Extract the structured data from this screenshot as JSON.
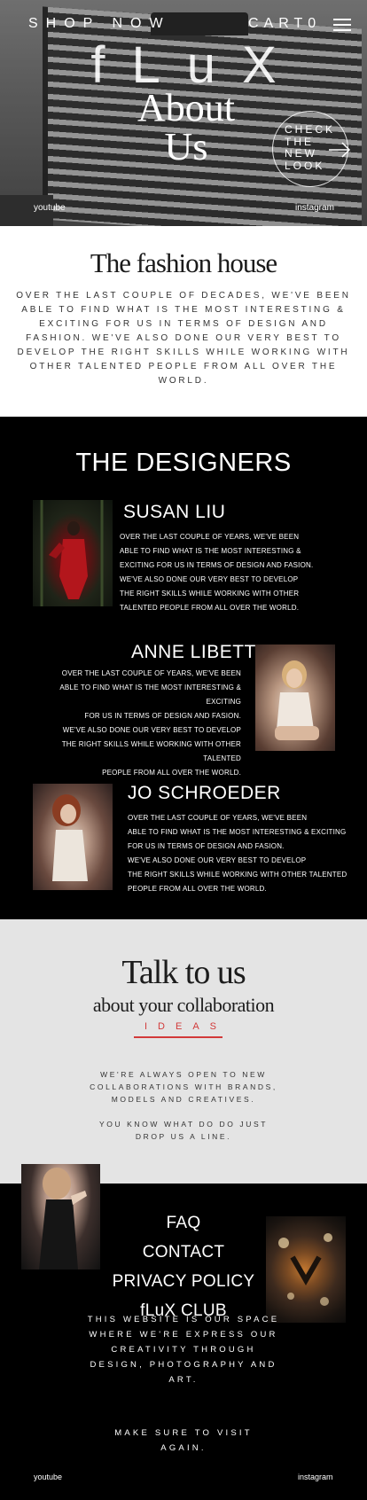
{
  "header": {
    "shop_label": "SHOP NOW",
    "cart_label": "CART0",
    "menu_icon": "hamburger-menu-icon",
    "brand": "fLuX"
  },
  "hero": {
    "title_line1": "About",
    "title_line2": "Us",
    "cta_line1": "CHECK",
    "cta_line2": "THE",
    "cta_line3": "NEW",
    "cta_line4": "LOOK",
    "cta_icon": "arrow-right-icon",
    "youtube": "youtube",
    "instagram": "instagram"
  },
  "fashion": {
    "title": "The fashion house",
    "text": "OVER THE LAST COUPLE OF DECADES, WE'VE BEEN ABLE TO FIND WHAT IS THE MOST INTERESTING & EXCITING FOR US IN TERMS OF DESIGN AND FASHION. WE'VE ALSO DONE OUR VERY BEST TO DEVELOP THE RIGHT SKILLS WHILE WORKING WITH OTHER TALENTED PEOPLE FROM ALL OVER THE WORLD."
  },
  "designers": {
    "title": "THE DESIGNERS",
    "items": [
      {
        "name": "SUSAN LIU",
        "lines": [
          "OVER THE LAST COUPLE OF YEARS, WE'VE BEEN",
          "ABLE TO FIND WHAT IS THE MOST INTERESTING &",
          "EXCITING FOR US IN TERMS OF DESIGN AND FASION.",
          "WE'VE ALSO DONE OUR VERY BEST TO DEVELOP",
          "THE RIGHT SKILLS WHILE WORKING WITH OTHER",
          "TALENTED PEOPLE FROM ALL OVER THE WORLD."
        ]
      },
      {
        "name": "ANNE LIBETT",
        "lines": [
          "OVER THE LAST COUPLE OF YEARS, WE'VE BEEN",
          "ABLE TO FIND WHAT IS THE MOST INTERESTING & EXCITING",
          "FOR US IN TERMS OF DESIGN AND FASION.",
          "WE'VE ALSO DONE OUR VERY BEST TO DEVELOP",
          "THE RIGHT SKILLS WHILE WORKING WITH OTHER TALENTED",
          "PEOPLE FROM ALL OVER THE WORLD."
        ]
      },
      {
        "name": "JO SCHROEDER",
        "lines": [
          "OVER THE LAST COUPLE OF YEARS, WE'VE BEEN",
          "ABLE TO FIND WHAT IS THE MOST INTERESTING & EXCITING",
          "FOR US IN TERMS OF DESIGN AND FASION.",
          "WE'VE ALSO DONE OUR VERY BEST TO DEVELOP",
          "THE RIGHT SKILLS WHILE WORKING WITH OTHER TALENTED",
          "PEOPLE FROM ALL OVER THE WORLD."
        ]
      }
    ]
  },
  "talk": {
    "title": "Talk to us",
    "subtitle": "about your collaboration",
    "ideas": "IDEAS",
    "text1": "WE'RE ALWAYS OPEN TO NEW COLLABORATIONS WITH BRANDS, MODELS AND CREATIVES.",
    "text2": "YOU KNOW WHAT DO DO JUST DROP US A LINE."
  },
  "footer": {
    "links": [
      "FAQ",
      "CONTACT",
      "PRIVACY POLICY",
      "fLuX CLUB"
    ],
    "text1": "THIS WEBSITE IS OUR SPACE WHERE WE'RE EXPRESS OUR CREATIVITY THROUGH DESIGN, PHOTOGRAPHY AND ART.",
    "text2": "MAKE SURE TO VISIT AGAIN.",
    "youtube": "youtube",
    "instagram": "instagram"
  },
  "colors": {
    "accent": "#d23a3a",
    "light_section": "#e4e4e4",
    "dark_section": "#000000"
  }
}
